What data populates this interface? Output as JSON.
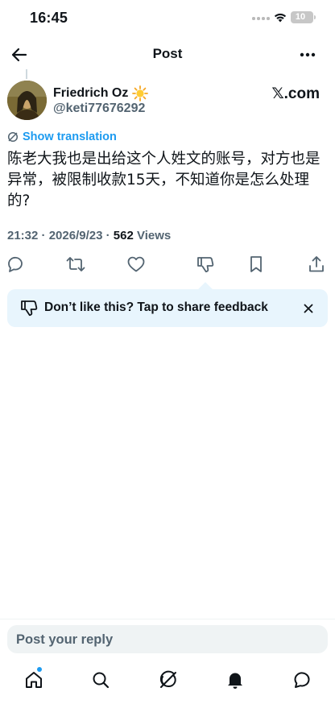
{
  "status_bar": {
    "time": "16:45",
    "battery": "10"
  },
  "header": {
    "title": "Post"
  },
  "author": {
    "name": "Friedrich Oz",
    "name_emoji": "sun-emoji",
    "handle": "@keti77676292",
    "source": "𝕏.com"
  },
  "post": {
    "show_translation": "Show translation",
    "text": "陈老大我也是出给这个人姓文的账号，对方也是异常，被限制收款15天，不知道你是怎么处理的?",
    "time": "21:32",
    "date": "2026/9/23",
    "views_count": "562",
    "views_label": "Views",
    "separator": " · "
  },
  "actions": {
    "icons": [
      "reply-icon",
      "retweet-icon",
      "like-icon",
      "dislike-icon",
      "bookmark-icon",
      "share-icon"
    ]
  },
  "feedback": {
    "text": "Don’t like this? Tap to share feedback"
  },
  "reply": {
    "placeholder": "Post your reply"
  },
  "tabbar": {
    "icons": [
      "home-icon",
      "search-icon",
      "grok-icon",
      "notifications-icon",
      "messages-icon"
    ]
  },
  "colors": {
    "accent": "#1d9bf0",
    "secondary_text": "#536471",
    "feedback_bg": "#e8f5fd"
  }
}
